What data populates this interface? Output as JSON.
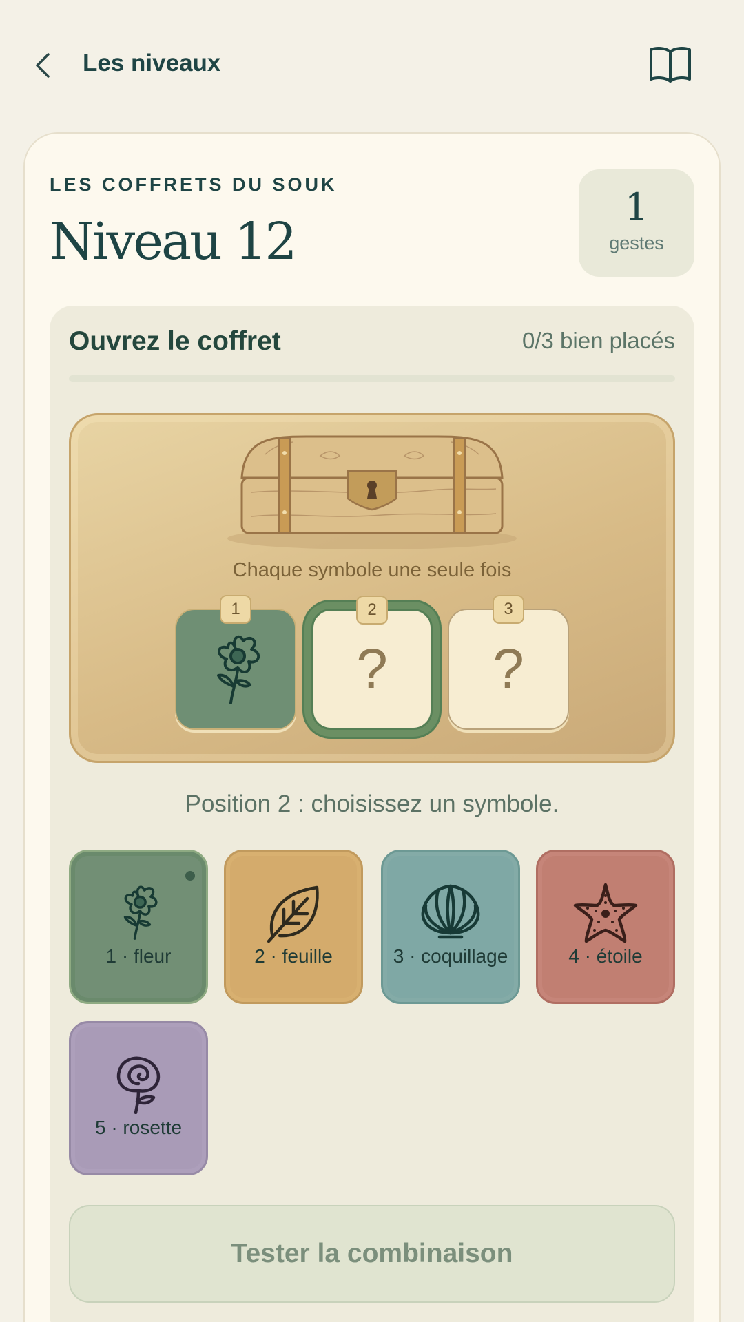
{
  "header": {
    "back_label": "Les niveaux",
    "back_icon": "chevron-left-icon",
    "book_icon": "open-book-icon"
  },
  "level": {
    "kicker": "LES COFFRETS DU SOUK",
    "title": "Niveau 12",
    "moves_value": "1",
    "moves_label": "gestes"
  },
  "puzzle": {
    "title": "Ouvrez le coffret",
    "placed_status": "0/3 bien placés",
    "progress_fraction": 0,
    "rule": "Chaque symbole une seule fois",
    "slots": [
      {
        "number": "1",
        "content": "fleur",
        "icon": "flower-icon"
      },
      {
        "number": "2",
        "content": "?",
        "selected": true
      },
      {
        "number": "3",
        "content": "?"
      }
    ],
    "hint": "Position 2 : choisissez un symbole.",
    "symbols": [
      {
        "label": "1 · fleur",
        "icon": "flower-icon",
        "color": "#728f75",
        "used": true
      },
      {
        "label": "2 · feuille",
        "icon": "leaf-icon",
        "color": "#d4ab6c"
      },
      {
        "label": "3 · coquillage",
        "icon": "shell-icon",
        "color": "#7fa8a5"
      },
      {
        "label": "4 · étoile",
        "icon": "starfish-icon",
        "color": "#c17f72"
      },
      {
        "label": "5 · rosette",
        "icon": "rose-icon",
        "color": "#a99bb7"
      }
    ],
    "submit_label": "Tester la combinaison"
  },
  "colors": {
    "background": "#f4f1e7",
    "card": "#fdf9ee",
    "accent_green": "#557f55",
    "text_dark": "#1f4545"
  }
}
